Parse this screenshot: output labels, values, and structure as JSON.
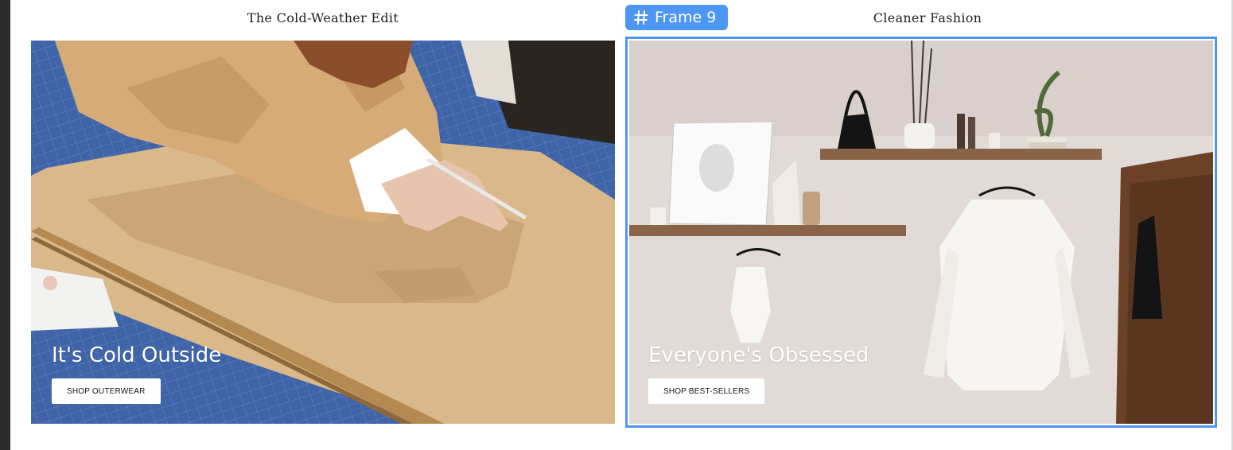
{
  "canvas": {
    "frame_label": "Frame 9",
    "frame_icon": "hash-icon",
    "selection_color": "#4d97f2"
  },
  "columns": [
    {
      "title": "The Cold-Weather Edit",
      "headline": "It's Cold Outside",
      "cta": "SHOP OUTERWEAR"
    },
    {
      "title": "Cleaner Fashion",
      "headline": "Everyone's Obsessed",
      "cta": "SHOP BEST-SELLERS"
    }
  ]
}
